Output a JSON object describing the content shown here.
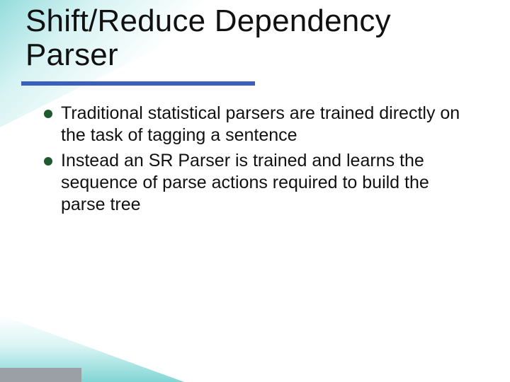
{
  "title": "Shift/Reduce Dependency Parser",
  "bullets": [
    "Traditional statistical parsers are trained directly on the task of tagging a sentence",
    "Instead an SR Parser is trained and learns the sequence of parse actions required to build the parse tree"
  ],
  "colors": {
    "accent_bar": "#3a5fbf",
    "bullet_dot": "#1e5a2e",
    "teal_wash": "#3fbfbf"
  }
}
